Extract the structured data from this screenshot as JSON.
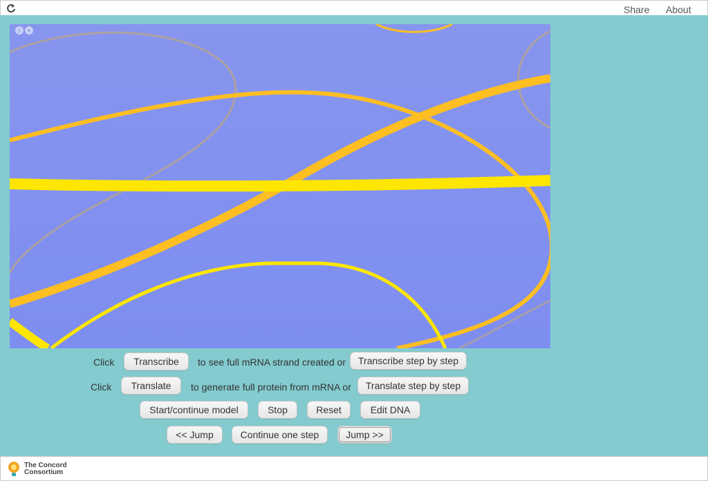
{
  "topbar": {
    "share_label": "Share",
    "about_label": "About",
    "reload_icon": "reload-icon"
  },
  "canvas": {
    "info_icon": "info-icon",
    "lock_icon": "lock-icon",
    "colors": {
      "background": "#8292ef",
      "dna_yellow": "#ffe600",
      "dna_orange": "#ffbe22",
      "faint_strand": "#b7a48e"
    }
  },
  "row1": {
    "click_label": "Click",
    "transcribe_button": "Transcribe",
    "middle_text": "to see full mRNA strand created or",
    "step_button": "Transcribe step by step"
  },
  "row2": {
    "click_label": "Click",
    "translate_button": "Translate",
    "middle_text": "to generate full protein from mRNA or",
    "step_button": "Translate step by step"
  },
  "row3": {
    "start_button": "Start/continue model",
    "stop_button": "Stop",
    "reset_button": "Reset",
    "edit_button": "Edit DNA"
  },
  "row4": {
    "jump_back_button": "<< Jump",
    "continue_button": "Continue one step",
    "jump_forward_button": "Jump >>"
  },
  "footer": {
    "logo_line1": "The Concord",
    "logo_line2": "Consortium"
  }
}
